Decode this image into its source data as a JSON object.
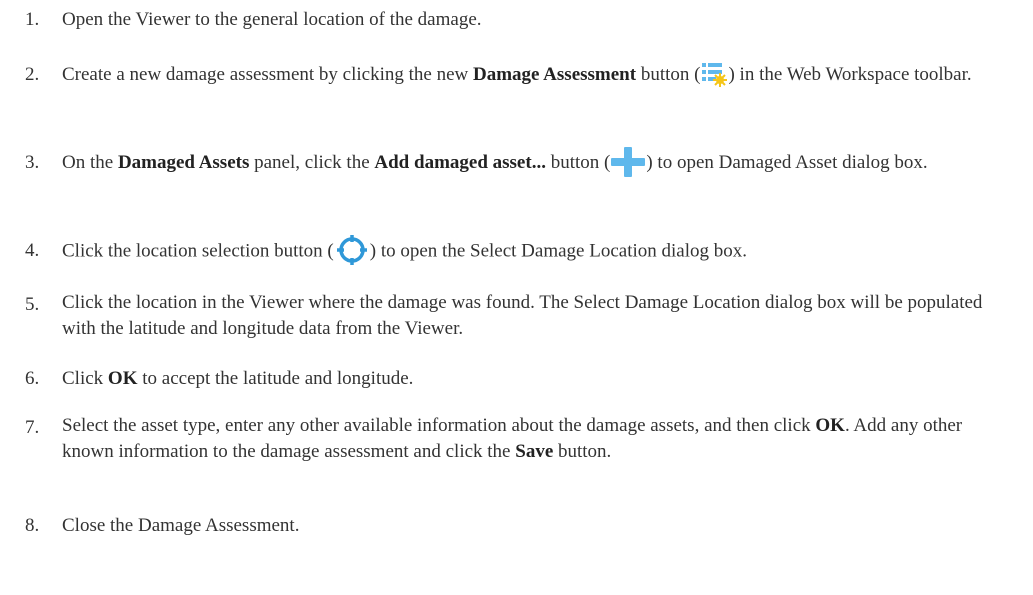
{
  "steps": [
    {
      "number": "1.",
      "parts": [
        "Open the Viewer to the general location of the damage."
      ]
    },
    {
      "number": "2.",
      "parts": [
        "Create a new damage assessment by clicking the new ",
        "Damage Assessment",
        " button (",
        ") in the Web Workspace toolbar."
      ],
      "icon": "damage-assessment-icon"
    },
    {
      "number": "3.",
      "parts": [
        "On the ",
        "Damaged Assets",
        " panel, click the ",
        "Add damaged asset...",
        " button (",
        ") to open Damaged Asset dialog box."
      ],
      "icon": "plus-icon"
    },
    {
      "number": "4.",
      "parts": [
        "Click the location selection button (",
        ") to open the Select Damage Location dialog box."
      ],
      "icon": "crosshair-icon"
    },
    {
      "number": "5.",
      "parts": [
        "Click the location in the Viewer where the damage was found. The Select Damage Location dialog box will be populated with the latitude and longitude data from the Viewer."
      ]
    },
    {
      "number": "6.",
      "parts": [
        "Click ",
        "OK",
        " to accept the latitude and longitude."
      ]
    },
    {
      "number": "7.",
      "parts": [
        "Select the asset type, enter any other available information about the damage assets, and then click ",
        "OK",
        ". Add any other known information to the damage assessment and click the ",
        "Save",
        " button."
      ]
    },
    {
      "number": "8.",
      "parts": [
        "Close the Damage Assessment."
      ]
    }
  ],
  "colors": {
    "text": "#333333",
    "icon_blue": "#2f98d8",
    "icon_light_blue": "#5fb8ec",
    "icon_yellow": "#f5c518"
  }
}
